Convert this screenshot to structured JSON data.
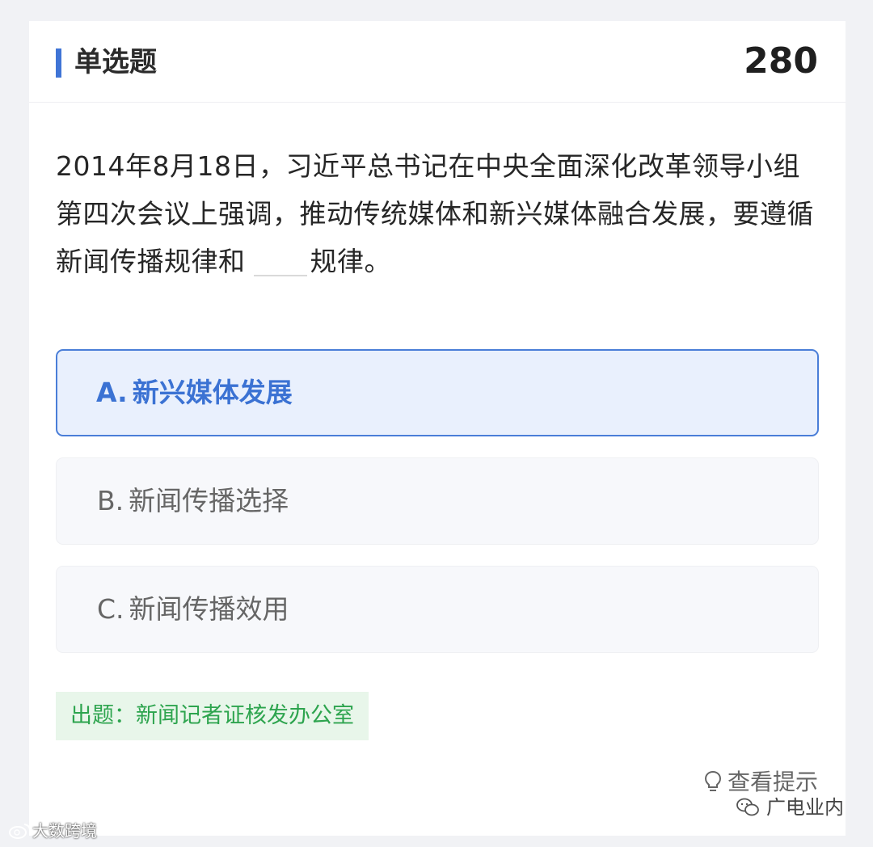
{
  "header": {
    "question_type": "单选题",
    "score": "280"
  },
  "question": {
    "text_before_blank": "2014年8月18日，习近平总书记在中央全面深化改革领导小组第四次会议上强调，推动传统媒体和新兴媒体融合发展，要遵循新闻传播规律和",
    "text_after_blank": "规律。"
  },
  "options": [
    {
      "key": "A.",
      "text": "新兴媒体发展",
      "selected": true
    },
    {
      "key": "B.",
      "text": "新闻传播选择",
      "selected": false
    },
    {
      "key": "C.",
      "text": "新闻传播效用",
      "selected": false
    }
  ],
  "source_label": "出题：新闻记者证核发办公室",
  "hint": {
    "icon": "lightbulb-icon",
    "label": "查看提示"
  },
  "watermarks": {
    "left": "大数跨境",
    "right": "广电业内"
  },
  "colors": {
    "accent": "#3f74d6",
    "selected_bg": "#e9f0fd",
    "source_green": "#2da44e",
    "source_bg": "#e8f6ea"
  }
}
